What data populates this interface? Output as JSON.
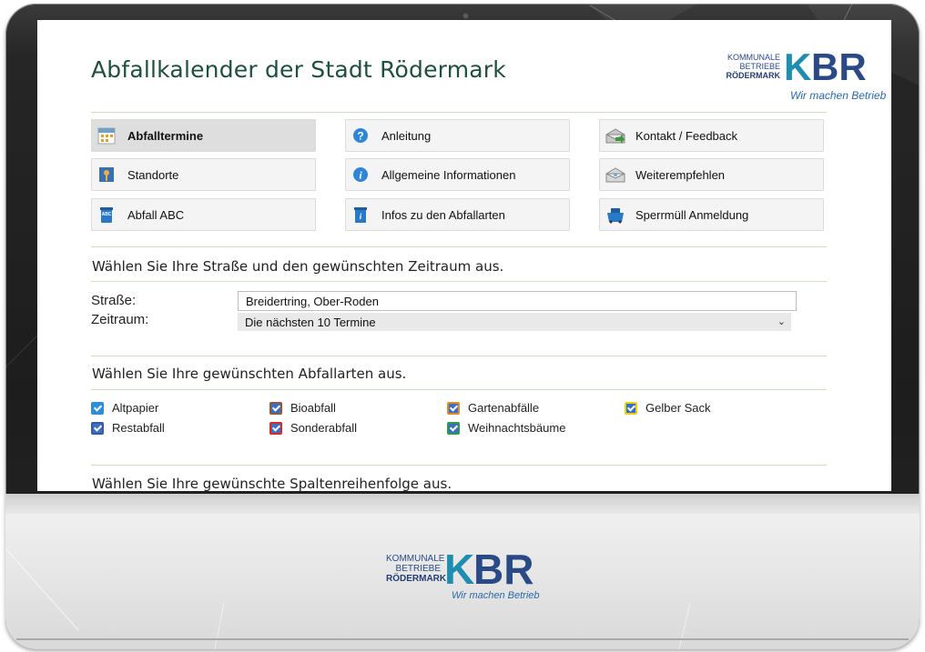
{
  "page": {
    "title": "Abfallkalender der Stadt Rödermark"
  },
  "brand": {
    "line1": "KOMMUNALE",
    "line2": "BETRIEBE",
    "line3": "RÖDERMARK",
    "k": "K",
    "br": "BR",
    "slogan": "Wir machen Betrieb"
  },
  "menu": {
    "items": [
      {
        "label": "Abfalltermine",
        "icon": "calendar-icon",
        "active": true
      },
      {
        "label": "Anleitung",
        "icon": "question-icon"
      },
      {
        "label": "Kontakt / Feedback",
        "icon": "mail-send-icon"
      },
      {
        "label": "Standorte",
        "icon": "map-pin-icon"
      },
      {
        "label": "Allgemeine Informationen",
        "icon": "info-icon"
      },
      {
        "label": "Weiterempfehlen",
        "icon": "mail-open-icon"
      },
      {
        "label": "Abfall ABC",
        "icon": "abc-bin-icon"
      },
      {
        "label": "Infos zu den Abfallarten",
        "icon": "info-bin-icon"
      },
      {
        "label": "Sperrmüll Anmeldung",
        "icon": "container-icon"
      }
    ]
  },
  "sections": {
    "street_period": "Wählen Sie Ihre Straße und den gewünschten Zeitraum aus.",
    "waste_types": "Wählen Sie Ihre gewünschten Abfallarten aus.",
    "column_order": "Wählen Sie Ihre gewünschte Spaltenreihenfolge aus."
  },
  "form": {
    "street_label": "Straße:",
    "street_value": "Breidertring, Ober-Roden",
    "period_label": "Zeitraum:",
    "period_value": "Die nächsten 10 Termine"
  },
  "waste_types": [
    {
      "label": "Altpapier",
      "checked": true,
      "color": "#2f8fd6"
    },
    {
      "label": "Bioabfall",
      "checked": true,
      "color": "#8a5a3c"
    },
    {
      "label": "Gartenabfälle",
      "checked": true,
      "color": "#e08a2a"
    },
    {
      "label": "Gelber Sack",
      "checked": true,
      "color": "#e6d21a"
    },
    {
      "label": "Restabfall",
      "checked": true,
      "color": "#3a5a9c"
    },
    {
      "label": "Sonderabfall",
      "checked": true,
      "color": "#d42a2a"
    },
    {
      "label": "Weihnachtsbäume",
      "checked": true,
      "color": "#2e9a4a"
    }
  ],
  "colors": {
    "title": "#1f4f3f",
    "rule": "#cfe0c8",
    "brand_k": "#1e8db0",
    "brand_br": "#2a4a86"
  }
}
